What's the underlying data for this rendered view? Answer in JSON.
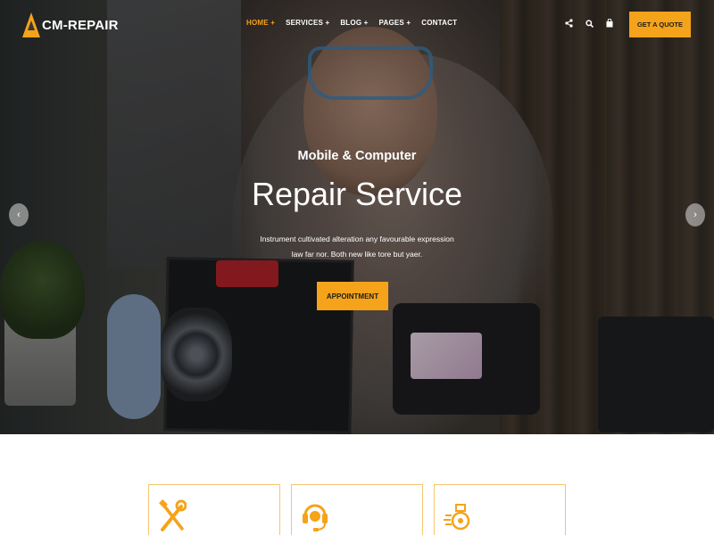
{
  "brand": {
    "name": "CM-REPAIR",
    "accent": "#f5a31a"
  },
  "nav": {
    "items": [
      {
        "label": "HOME +",
        "active": true
      },
      {
        "label": "SERVICES +",
        "active": false
      },
      {
        "label": "BLOG +",
        "active": false
      },
      {
        "label": "PAGES +",
        "active": false
      },
      {
        "label": "CONTACT",
        "active": false
      }
    ]
  },
  "header": {
    "icons": [
      "share-icon",
      "search-icon",
      "shopping-bag-icon"
    ],
    "cta_label": "GET A QUOTE"
  },
  "hero": {
    "subtitle": "Mobile & Computer",
    "title": "Repair Service",
    "description": "Instrument cultivated alteration any favourable expression law far nor. Both new like tore but yaer.",
    "button_label": "APPOINTMENT",
    "prev_arrow": "‹",
    "next_arrow": "›"
  },
  "features": {
    "cards": [
      {
        "icon": "tools-icon"
      },
      {
        "icon": "headset-support-icon"
      },
      {
        "icon": "fast-delivery-icon"
      }
    ]
  }
}
